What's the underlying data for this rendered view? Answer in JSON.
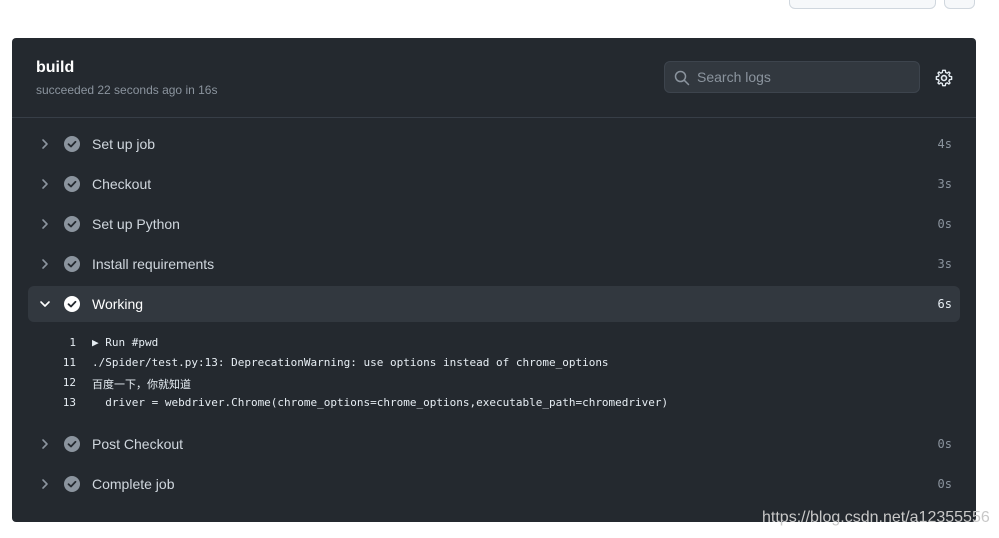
{
  "job": {
    "title": "build",
    "subtitle": "succeeded 22 seconds ago in 16s"
  },
  "search": {
    "placeholder": "Search logs"
  },
  "steps": [
    {
      "name": "Set up job",
      "duration": "4s",
      "expanded": false
    },
    {
      "name": "Checkout",
      "duration": "3s",
      "expanded": false
    },
    {
      "name": "Set up Python",
      "duration": "0s",
      "expanded": false
    },
    {
      "name": "Install requirements",
      "duration": "3s",
      "expanded": false
    },
    {
      "name": "Working",
      "duration": "6s",
      "expanded": true
    },
    {
      "name": "Post Checkout",
      "duration": "0s",
      "expanded": false
    },
    {
      "name": "Complete job",
      "duration": "0s",
      "expanded": false
    }
  ],
  "log_lines": [
    {
      "num": "1",
      "text": "▶ Run #pwd"
    },
    {
      "num": "11",
      "text": "./Spider/test.py:13: DeprecationWarning: use options instead of chrome_options"
    },
    {
      "num": "12",
      "text": "百度一下，你就知道"
    },
    {
      "num": "13",
      "text": "  driver = webdriver.Chrome(chrome_options=chrome_options,executable_path=chromedriver)"
    }
  ],
  "watermark": "https://blog.csdn.net/a12355556",
  "colors": {
    "panel_bg": "#24292f",
    "check": "#8b949e"
  },
  "icons": {
    "search": "search-icon",
    "settings": "gear-icon",
    "chevron": "chevron-icon",
    "status": "check-circle-icon"
  }
}
